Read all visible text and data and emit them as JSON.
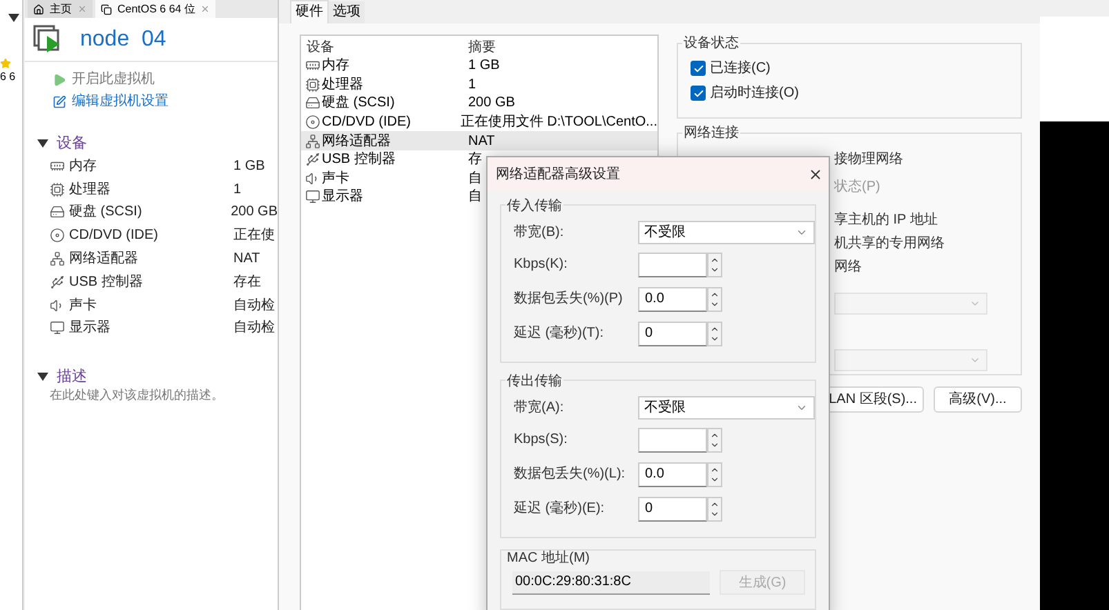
{
  "library": {
    "entry_fragment": "6 6"
  },
  "tabs": [
    {
      "label": "主页",
      "selected": false
    },
    {
      "label": "CentOS 6 64 位",
      "selected": true
    }
  ],
  "vm": {
    "name": "node  04",
    "actions": [
      {
        "kind": "power",
        "label": "开启此虚拟机"
      },
      {
        "kind": "edit",
        "label": "编辑虚拟机设置"
      }
    ],
    "devices_heading": "设备",
    "devices": [
      {
        "kind": "memory",
        "name": "内存",
        "value": "1 GB"
      },
      {
        "kind": "cpu",
        "name": "处理器",
        "value": "1"
      },
      {
        "kind": "disk",
        "name": "硬盘 (SCSI)",
        "value": "200 GB"
      },
      {
        "kind": "cd",
        "name": "CD/DVD (IDE)",
        "value": "正在使"
      },
      {
        "kind": "network",
        "name": "网络适配器",
        "value": "NAT"
      },
      {
        "kind": "usb",
        "name": "USB 控制器",
        "value": "存在"
      },
      {
        "kind": "sound",
        "name": "声卡",
        "value": "自动检"
      },
      {
        "kind": "display",
        "name": "显示器",
        "value": "自动检"
      }
    ],
    "description_heading": "描述",
    "description_hint": "在此处键入对该虚拟机的描述。"
  },
  "settings": {
    "tabs": [
      {
        "label": "硬件",
        "selected": true
      },
      {
        "label": "选项",
        "selected": false
      }
    ],
    "columns": [
      "设备",
      "摘要"
    ],
    "rows": [
      {
        "kind": "memory",
        "device": "内存",
        "summary": "1 GB",
        "selected": false
      },
      {
        "kind": "cpu",
        "device": "处理器",
        "summary": "1",
        "selected": false
      },
      {
        "kind": "disk",
        "device": "硬盘 (SCSI)",
        "summary": "200 GB",
        "selected": false
      },
      {
        "kind": "cd",
        "device": "CD/DVD (IDE)",
        "summary": "正在使用文件 D:\\TOOL\\CentO...",
        "selected": false
      },
      {
        "kind": "network",
        "device": "网络适配器",
        "summary": "NAT",
        "selected": true
      },
      {
        "kind": "usb",
        "device": "USB 控制器",
        "summary": "存",
        "selected": false
      },
      {
        "kind": "sound",
        "device": "声卡",
        "summary": "自",
        "selected": false
      },
      {
        "kind": "display",
        "device": "显示器",
        "summary": "自",
        "selected": false
      }
    ],
    "device_status": {
      "title": "设备状态",
      "options": [
        {
          "label": "已连接(C)",
          "checked": true
        },
        {
          "label": "启动时连接(O)",
          "checked": true
        }
      ]
    },
    "network": {
      "title": "网络连接",
      "fragments": [
        "接物理网络",
        "状态(P)",
        "享主机的 IP 地址",
        "机共享的专用网络",
        "网络"
      ],
      "buttons": [
        "LAN 区段(S)...",
        "高级(V)..."
      ]
    }
  },
  "advanced": {
    "title": "网络适配器高级设置",
    "groups": [
      {
        "title": "传入传输",
        "rows": [
          {
            "kind": "select",
            "label": "带宽(B):",
            "value": "不受限"
          },
          {
            "kind": "spin",
            "label": "Kbps(K):"
          },
          {
            "kind": "spin",
            "label": "数据包丢失(%)(P)",
            "value": "0.0"
          },
          {
            "kind": "spin",
            "label": "延迟 (毫秒)(T):",
            "value": "0"
          }
        ]
      },
      {
        "title": "传出传输",
        "rows": [
          {
            "kind": "select",
            "label": "带宽(A):",
            "value": "不受限"
          },
          {
            "kind": "spin",
            "label": "Kbps(S):"
          },
          {
            "kind": "spin",
            "label": "数据包丢失(%)(L):",
            "value": "0.0"
          },
          {
            "kind": "spin",
            "label": "延迟 (毫秒)(E):",
            "value": "0"
          }
        ]
      }
    ],
    "mac": {
      "title": "MAC 地址(M)",
      "value": "00:0C:29:80:31:8C",
      "button": {
        "label": "生成(G)",
        "disabled": true
      }
    }
  }
}
